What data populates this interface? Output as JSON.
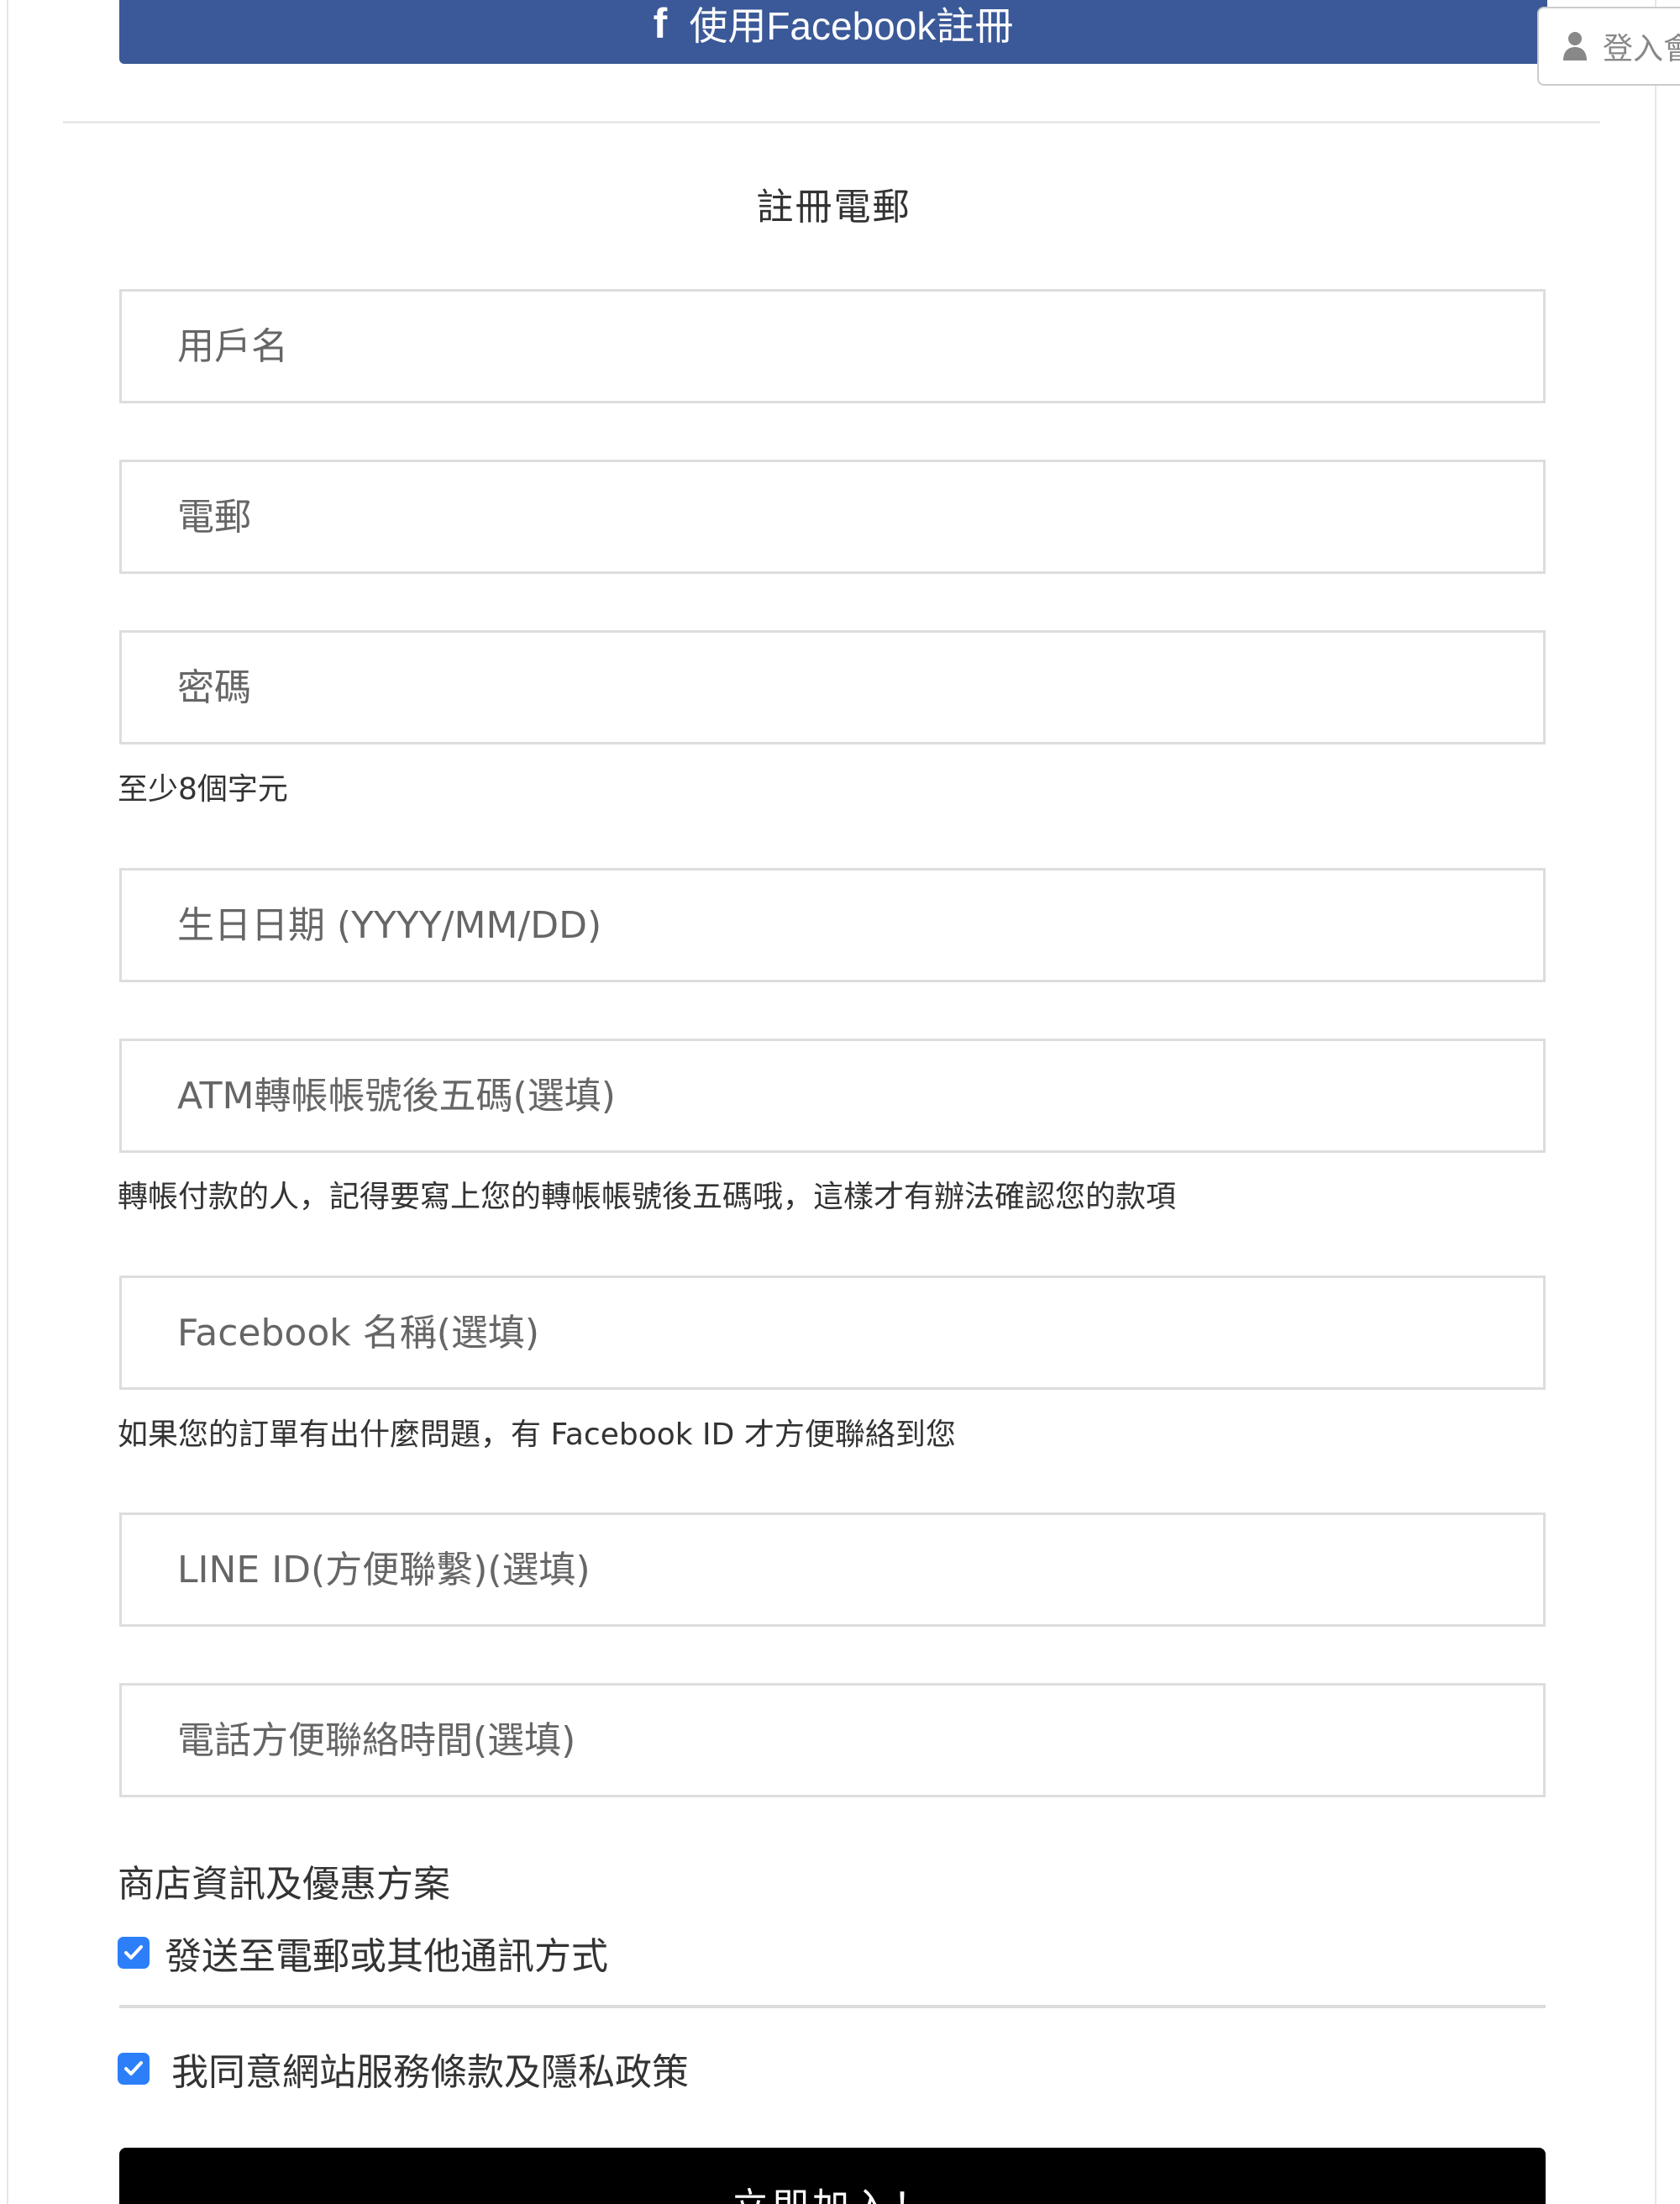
{
  "facebook_signup": {
    "icon": "facebook-icon",
    "label": "使用Facebook註冊"
  },
  "login_tab": {
    "icon": "user-icon",
    "label": "登入會"
  },
  "section_title": "註冊電郵",
  "fields": {
    "username": {
      "placeholder": "用戶名"
    },
    "email": {
      "placeholder": "電郵"
    },
    "password": {
      "placeholder": "密碼",
      "hint": "至少8個字元"
    },
    "birthday": {
      "placeholder": "生日日期 (YYYY/MM/DD)"
    },
    "atm_last5": {
      "placeholder": "ATM轉帳帳號後五碼(選填)",
      "hint": "轉帳付款的人，記得要寫上您的轉帳帳號後五碼哦，這樣才有辦法確認您的款項"
    },
    "facebook_name": {
      "placeholder": "Facebook 名稱(選填)",
      "hint": "如果您的訂單有出什麼問題，有 Facebook ID 才方便聯絡到您"
    },
    "line_id": {
      "placeholder": "LINE ID(方便聯繫)(選填)"
    },
    "contact_time": {
      "placeholder": "電話方便聯絡時間(選填)"
    }
  },
  "promo": {
    "title": "商店資訊及優惠方案",
    "send_label": "發送至電郵或其他通訊方式",
    "send_checked": true
  },
  "terms": {
    "label": "我同意網站服務條款及隱私政策",
    "checked": true
  },
  "submit_label": "立即加入！",
  "colors": {
    "facebook_blue": "#3b5998",
    "checkbox_blue": "#2d7ff9",
    "submit_black": "#000000",
    "border_gray": "#dddddd"
  }
}
